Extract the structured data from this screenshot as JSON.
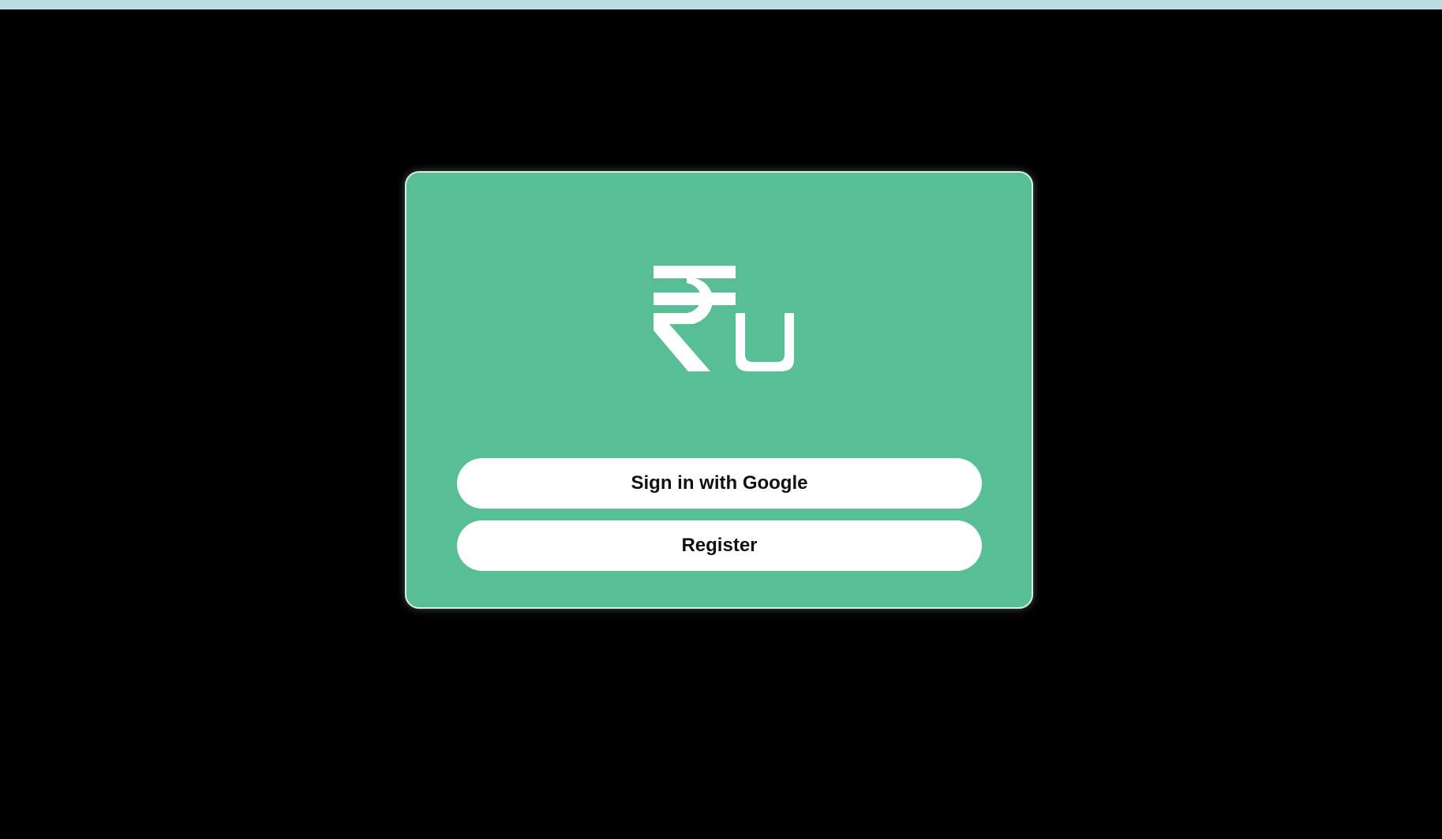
{
  "theme": {
    "page_background": "#000000",
    "top_strip": "#b9dde3",
    "card_background": "#57be96",
    "card_border": "#d8f1e6",
    "button_background": "#ffffff",
    "button_text": "#111111",
    "logo_color": "#ffffff"
  },
  "logo": {
    "icon": "rupee-u-logo",
    "letter": "U"
  },
  "actions": {
    "google_label": "Sign in with Google",
    "register_label": "Register"
  }
}
